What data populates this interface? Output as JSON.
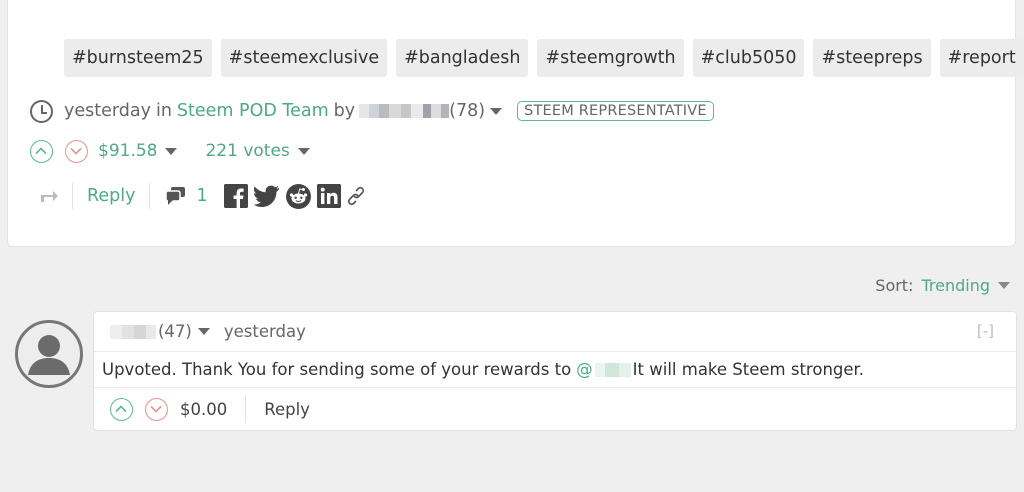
{
  "post": {
    "tags": [
      "#burnsteem25",
      "#steemexclusive",
      "#bangladesh",
      "#steemgrowth",
      "#club5050",
      "#steepreps",
      "#report"
    ],
    "meta": {
      "time": "yesterday",
      "in_word": "in",
      "community": "Steem POD Team",
      "by_word": "by",
      "reputation": "(78)",
      "badge": "STEEM REPRESENTATIVE"
    },
    "payout": "$91.58",
    "votes": "221 votes",
    "reply_label": "Reply",
    "comment_count": "1"
  },
  "sort": {
    "label": "Sort:",
    "value": "Trending"
  },
  "comment": {
    "reputation": "(47)",
    "time": "yesterday",
    "collapse": "[-]",
    "body_prefix": "Upvoted. Thank You for sending some of your rewards to",
    "mention_at": "@",
    "body_suffix": "It will make Steem stronger.",
    "payout": "$0.00",
    "reply_label": "Reply"
  },
  "colors": {
    "accent_green": "#4fa986",
    "downvote_red": "#ee9090",
    "background": "#efefef"
  },
  "icons": [
    "clock-icon",
    "upvote-icon",
    "downvote-icon",
    "resteem-icon",
    "comments-icon",
    "facebook-icon",
    "twitter-icon",
    "reddit-icon",
    "linkedin-icon",
    "permalink-icon",
    "avatar-icon"
  ]
}
